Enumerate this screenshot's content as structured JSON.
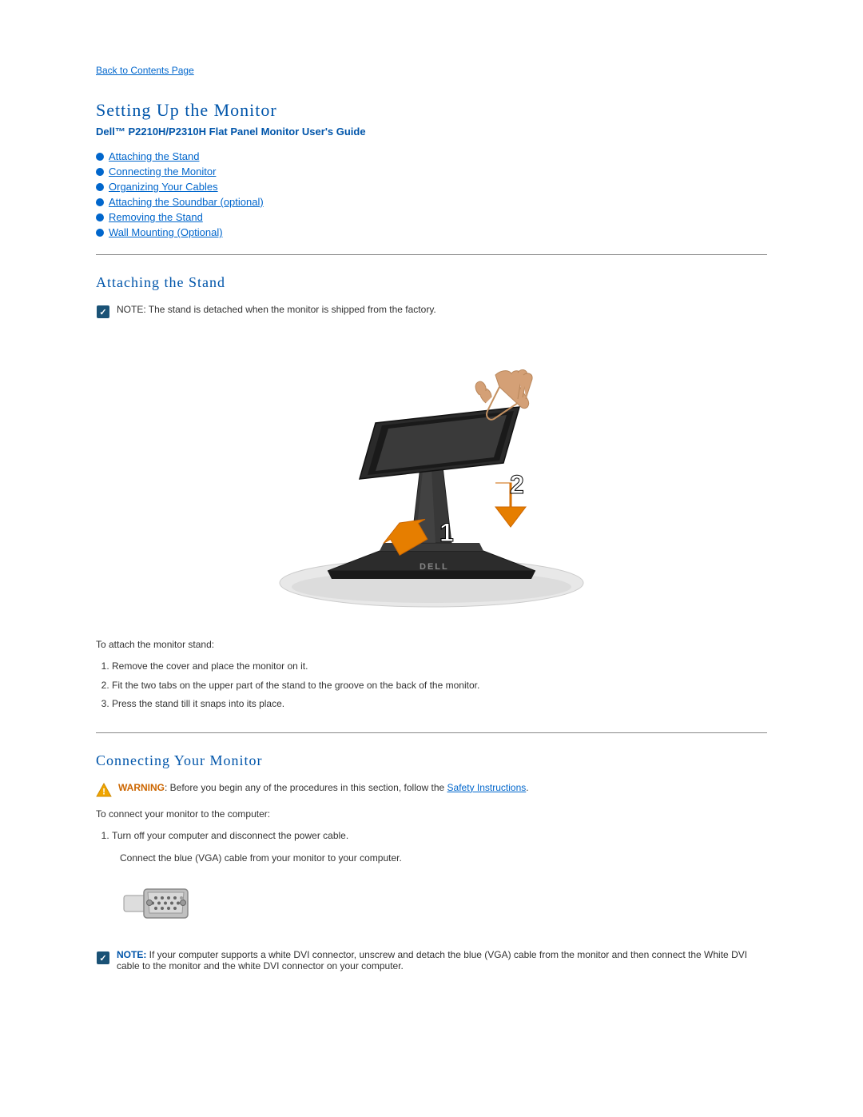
{
  "back_link": "Back to Contents Page",
  "page_title": "Setting Up the Monitor",
  "subtitle": "Dell™ P2210H/P2310H Flat Panel Monitor User's Guide",
  "nav_items": [
    "Attaching the Stand",
    "Connecting the Monitor",
    "Organizing Your Cables",
    "Attaching the Soundbar (optional)",
    "Removing the Stand",
    "Wall Mounting (Optional)"
  ],
  "sections": {
    "attaching_stand": {
      "title": "Attaching the Stand",
      "note": "NOTE: The stand is detached when the monitor is shipped from the factory.",
      "caption": "To attach the monitor stand:",
      "steps": [
        "Remove the cover and place the monitor on it.",
        "Fit the two tabs on the upper part of the stand to the groove on the back of the monitor.",
        "Press the stand till it snaps into its place."
      ]
    },
    "connecting_monitor": {
      "title": "Connecting Your Monitor",
      "warning_label": "WARNING",
      "warning_text": ": Before you begin any of the procedures in this section, follow the ",
      "warning_link": "Safety Instructions",
      "warning_end": ".",
      "to_connect": "To connect your monitor to the computer:",
      "step1": "Turn off your computer and disconnect the power cable.",
      "connect_blue": "Connect the blue (VGA) cable from your monitor to your computer.",
      "note2_label": "NOTE:",
      "note2_text": " If your computer supports a white DVI connector, unscrew and detach the blue (VGA) cable from the monitor and then connect the White DVI cable to the monitor and the white DVI connector on your computer."
    }
  }
}
